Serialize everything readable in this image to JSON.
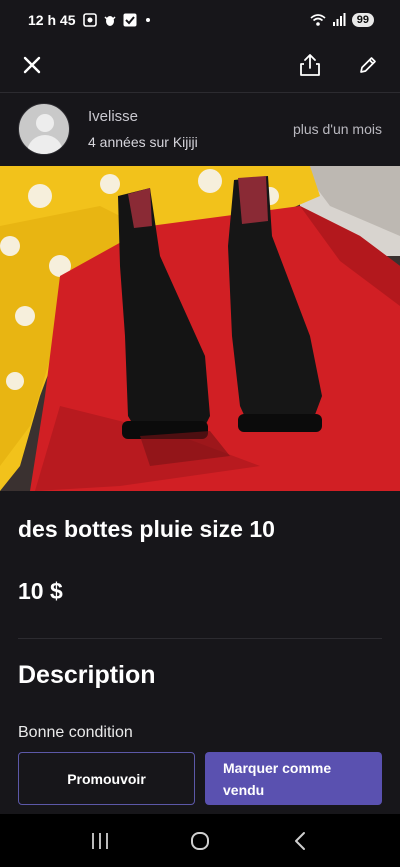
{
  "status_bar": {
    "time": "12 h 45",
    "battery": "99"
  },
  "toolbar": {
    "close_icon": "close-icon",
    "share_icon": "share-icon",
    "edit_icon": "pencil-icon"
  },
  "seller": {
    "name": "Ivelisse",
    "tenure": "4 années sur Kijiji",
    "posted": "plus d'un mois"
  },
  "listing": {
    "title": "des bottes pluie size 10",
    "price": "10 $",
    "description_heading": "Description",
    "description": "Bonne condition"
  },
  "actions": {
    "promote_label": "Promouvoir",
    "sold_label_line1": "Marquer comme",
    "sold_label_line2": "vendu"
  },
  "colors": {
    "background": "#17161a",
    "accent": "#5a51b0",
    "outline": "#5c58a8"
  }
}
